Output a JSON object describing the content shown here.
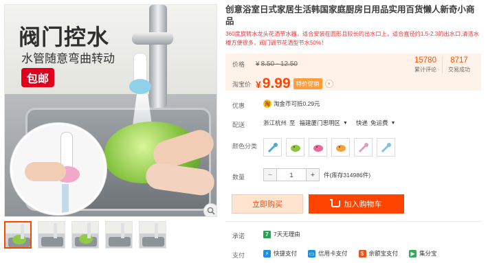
{
  "gallery": {
    "overlay_title": "阀门控水",
    "overlay_subtitle": "水管随意弯曲转动",
    "overlay_badge": "包邮",
    "zoom_icon": "magnifier-icon",
    "thumbnail_count": 5
  },
  "product": {
    "title": "创意浴室日式家居生活韩国家庭厨房日用品实用百货懒人新奇小商品",
    "description": "360度旋转水龙头花洒节水器，适合安装在圆形且较长的出水口上，适合直径约1.5-2.3的出水口,清洁水槽方便很多，阀门调节花洒型节水50%！"
  },
  "price": {
    "label_price": "价格",
    "currency": "¥",
    "original": "8.50 - 12.50",
    "label_taobao": "淘宝价",
    "current": "9.99",
    "promo_label": "特价促销",
    "stats": [
      {
        "num": "15780",
        "caption": "累计评论"
      },
      {
        "num": "8717",
        "caption": "交易成功"
      }
    ]
  },
  "benefits": {
    "label": "优惠",
    "coin_text": "淘金币可抵0.29元"
  },
  "shipping": {
    "label": "配送",
    "from": "浙江杭州",
    "to_word": "至",
    "destination": "福建厦门思明区",
    "method": "快递",
    "fee": "免运费"
  },
  "colors": {
    "label": "颜色分类",
    "swatch_colors": [
      "#4aa9d6",
      "#8fc43b",
      "#e76a9a",
      "#f0a33a",
      "#e59ac0",
      "#7fc0e3"
    ]
  },
  "quantity": {
    "label": "数量",
    "value": "1",
    "unit": "件",
    "stock": "(库存314986件)"
  },
  "buttons": {
    "buy_now": "立即购买",
    "add_cart": "加入购物车"
  },
  "promise": {
    "label": "承诺",
    "badge": "7",
    "text": "7天无理由"
  },
  "payment": {
    "label": "支付",
    "methods": [
      {
        "text": "快捷支付",
        "color": "#1a8fe3",
        "icon": "express-pay-icon"
      },
      {
        "text": "信用卡支付",
        "color": "#1a8fe3",
        "icon": "credit-card-icon"
      },
      {
        "text": "余额宝支付",
        "color": "#e8541e",
        "icon": "yuebao-icon"
      },
      {
        "text": "集分宝",
        "color": "#2fae5b",
        "icon": "jifenbao-icon"
      }
    ]
  },
  "colors_theme": {
    "accent": "#ff4400",
    "price_text": "#ff5000",
    "price_bg": "#fff2e8"
  }
}
